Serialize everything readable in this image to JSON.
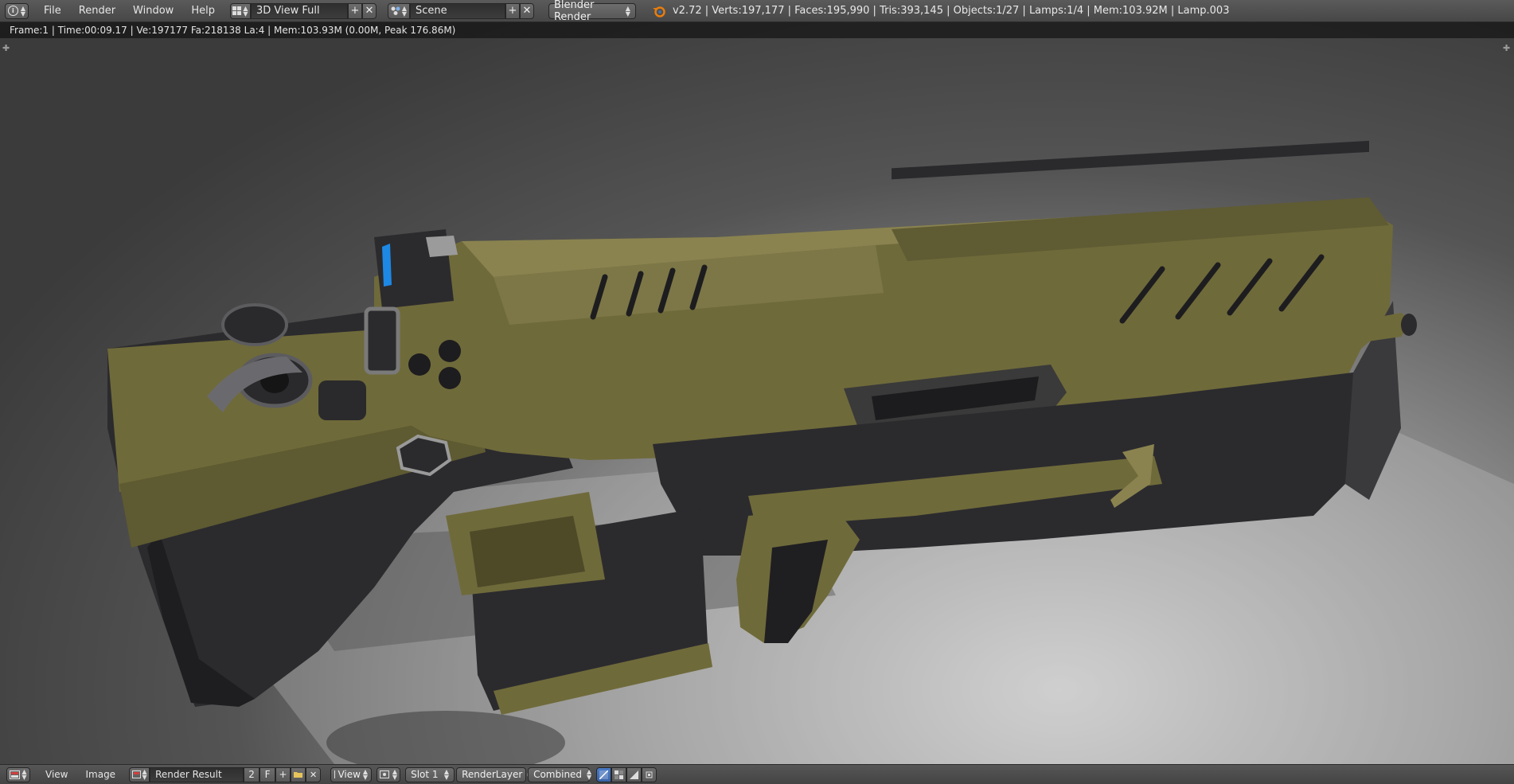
{
  "top_header": {
    "menus": [
      "File",
      "Render",
      "Window",
      "Help"
    ],
    "screen_layout": "3D View Full",
    "scene": "Scene",
    "render_engine": "Blender Render",
    "stats": "v2.72 | Verts:197,177 | Faces:195,990 | Tris:393,145 | Objects:1/27 | Lamps:1/4 | Mem:103.92M | Lamp.003",
    "add_symbol": "+",
    "remove_symbol": "✕"
  },
  "viewport": {
    "render_info": "Frame:1 | Time:00:09.17 | Ve:197177 Fa:218138 La:4 | Mem:103.93M (0.00M, Peak 176.86M)"
  },
  "bottom_header": {
    "menus": [
      "View",
      "Image"
    ],
    "image_name": "Render Result",
    "users_count": "2",
    "fake_user": "F",
    "view_mode": "View",
    "slot": "Slot 1",
    "render_layer": "RenderLayer",
    "pass": "Combined"
  },
  "colors": {
    "body_olive": "#6f6a3a",
    "body_olive_light": "#8a8350",
    "metal_dark": "#2a2a2d",
    "accent_blue": "#1e88e5",
    "active_button": "#4a7bc6"
  },
  "icons": [
    "info-editor-icon",
    "screen-layout-icon",
    "scene-icon",
    "blender-logo-icon",
    "image-editor-icon",
    "image-browse-icon",
    "new-image-icon",
    "open-image-icon",
    "camera-view-icon",
    "pin-icon",
    "channel-icon",
    "alpha-icon",
    "zdepth-icon"
  ]
}
